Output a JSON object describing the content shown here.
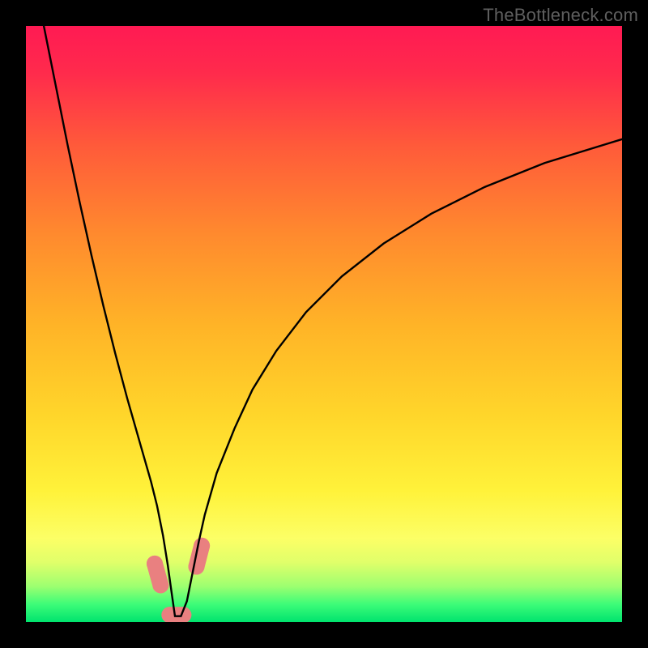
{
  "watermark": "TheBottleneck.com",
  "chart_data": {
    "type": "line",
    "title": "",
    "xlabel": "",
    "ylabel": "",
    "xlim": [
      0,
      100
    ],
    "ylim": [
      0,
      100
    ],
    "background_gradient": {
      "stops": [
        {
          "pos": 0.0,
          "color": "#ff1a53"
        },
        {
          "pos": 0.08,
          "color": "#ff2b4c"
        },
        {
          "pos": 0.2,
          "color": "#ff5a3a"
        },
        {
          "pos": 0.35,
          "color": "#ff8a2e"
        },
        {
          "pos": 0.5,
          "color": "#ffb327"
        },
        {
          "pos": 0.65,
          "color": "#ffd52a"
        },
        {
          "pos": 0.78,
          "color": "#fff23a"
        },
        {
          "pos": 0.86,
          "color": "#fcff66"
        },
        {
          "pos": 0.9,
          "color": "#e0ff6a"
        },
        {
          "pos": 0.94,
          "color": "#9dff70"
        },
        {
          "pos": 0.97,
          "color": "#3dfc78"
        },
        {
          "pos": 1.0,
          "color": "#00e36e"
        }
      ]
    },
    "series": [
      {
        "name": "bottleneck-curve",
        "x": [
          3,
          5,
          7,
          9,
          11,
          13,
          15,
          17,
          19,
          21,
          22,
          23,
          23.8,
          24.5,
          25,
          26,
          27,
          28,
          29,
          30,
          32,
          35,
          38,
          42,
          47,
          53,
          60,
          68,
          77,
          87,
          100
        ],
        "y": [
          100,
          90,
          80,
          70.5,
          61.5,
          53,
          45,
          37.5,
          30.5,
          23.5,
          19.5,
          14.5,
          9.5,
          4.5,
          1.0,
          1.0,
          3.5,
          8.5,
          13.5,
          18,
          25,
          32.5,
          39,
          45.5,
          52,
          58,
          63.5,
          68.5,
          73,
          77,
          81
        ]
      }
    ],
    "markers": [
      {
        "name": "marker-left-descent-1",
        "x": 21.6,
        "y": 9.8
      },
      {
        "name": "marker-left-descent-2",
        "x": 22.6,
        "y": 6.2
      },
      {
        "name": "marker-valley-left",
        "x": 24.1,
        "y": 1.2
      },
      {
        "name": "marker-valley-right",
        "x": 26.4,
        "y": 1.2
      },
      {
        "name": "marker-right-ascent-1",
        "x": 28.6,
        "y": 9.3
      },
      {
        "name": "marker-right-ascent-2",
        "x": 29.5,
        "y": 12.8
      }
    ],
    "marker_style": {
      "color": "#e98080",
      "radius_px": 10,
      "pill_pairs": [
        [
          0,
          1
        ],
        [
          2,
          3
        ],
        [
          4,
          5
        ]
      ]
    }
  }
}
